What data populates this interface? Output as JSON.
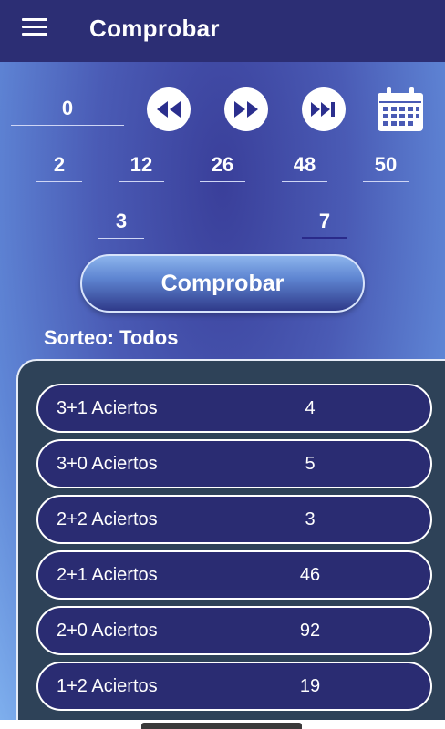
{
  "header": {
    "title": "Comprobar"
  },
  "draw_input": {
    "value": "0"
  },
  "numbers": [
    "2",
    "12",
    "26",
    "48",
    "50"
  ],
  "stars": [
    "3",
    "7"
  ],
  "check_button": "Comprobar",
  "sorteo_label": "Sorteo: Todos",
  "results": [
    {
      "label": "3+1 Aciertos",
      "count": "4"
    },
    {
      "label": "3+0 Aciertos",
      "count": "5"
    },
    {
      "label": "2+2 Aciertos",
      "count": "3"
    },
    {
      "label": "2+1 Aciertos",
      "count": "46"
    },
    {
      "label": "2+0 Aciertos",
      "count": "92"
    },
    {
      "label": "1+2 Aciertos",
      "count": "19"
    }
  ],
  "colors": {
    "topbar": "#2c2e74",
    "row_bg": "#2a2c72",
    "panel_bg": "#2e4258",
    "icon_accent": "#2b2f8e"
  },
  "icons": [
    "menu-icon",
    "rewind-icon",
    "fast-forward-icon",
    "skip-to-end-icon",
    "calendar-icon"
  ]
}
